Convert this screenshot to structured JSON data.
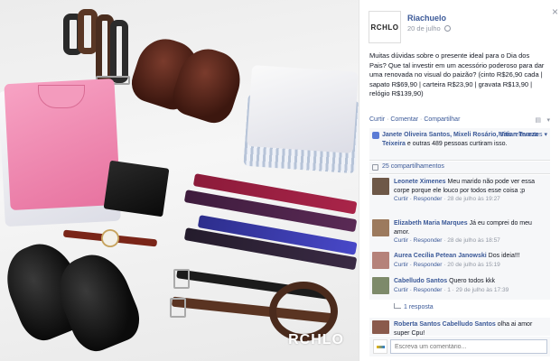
{
  "photo": {
    "watermark": "RCHLO"
  },
  "post": {
    "page_name": "Riachuelo",
    "page_logo_text": "RCHLO",
    "date": "20 de julho",
    "text": "Muitas dúvidas sobre o presente ideal para o Dia dos Pais? Que tal investir em um acessório poderoso para dar uma renovada no visual do paizão? (cinto R$26,90 cada | sapato R$69,90 | carteira R$23,90 | gravata R$13,90 | relógio R$139,90)",
    "actions": [
      "Curtir",
      "Comentar",
      "Compartilhar"
    ]
  },
  "likes": {
    "names": "Janete Oliveira Santos, Mixeli Rosário, Vitian Tereza Teixeira",
    "suffix": "e outras 489 pessoas curtiram isso.",
    "relevant_label": "Mais relevantes"
  },
  "shares": {
    "label": "25 compartilhamentos"
  },
  "comments": [
    {
      "author": "Leonete Ximenes",
      "text": "Meu marido não pode ver essa corpe porque ele louco por todos esse coisa ;p",
      "meta_actions": "Curtir · Responder",
      "time": "28 de julho às 19:27",
      "avatar_color": "#6e5848"
    },
    {
      "author": "Elizabeth Maria Marques",
      "text": "Já eu comprei do meu amor.",
      "meta_actions": "Curtir · Responder",
      "time": "28 de julho às 18:57",
      "avatar_color": "#9c7a5e"
    },
    {
      "author": "Aurea Cecília Petean Janowski",
      "text": "Dos ideia!!!",
      "meta_actions": "Curtir · Responder",
      "time": "20 de julho às 15:19",
      "avatar_color": "#b5827a"
    },
    {
      "author": "Cabelludo Santos",
      "text": "Quero todos kkk",
      "meta_actions": "Curtir · Responder",
      "time": "1 · 29 de julho às 17:39",
      "avatar_color": "#7d8a6a"
    },
    {
      "author": "Roberta Santos Cabelludo Santos",
      "text": "olha ai amor super Cpu!",
      "meta_actions": "",
      "time": "",
      "avatar_color": "#8a5a4c"
    }
  ],
  "reply_link": "1 resposta",
  "comment_input": {
    "placeholder": "Escreva um comentário..."
  }
}
